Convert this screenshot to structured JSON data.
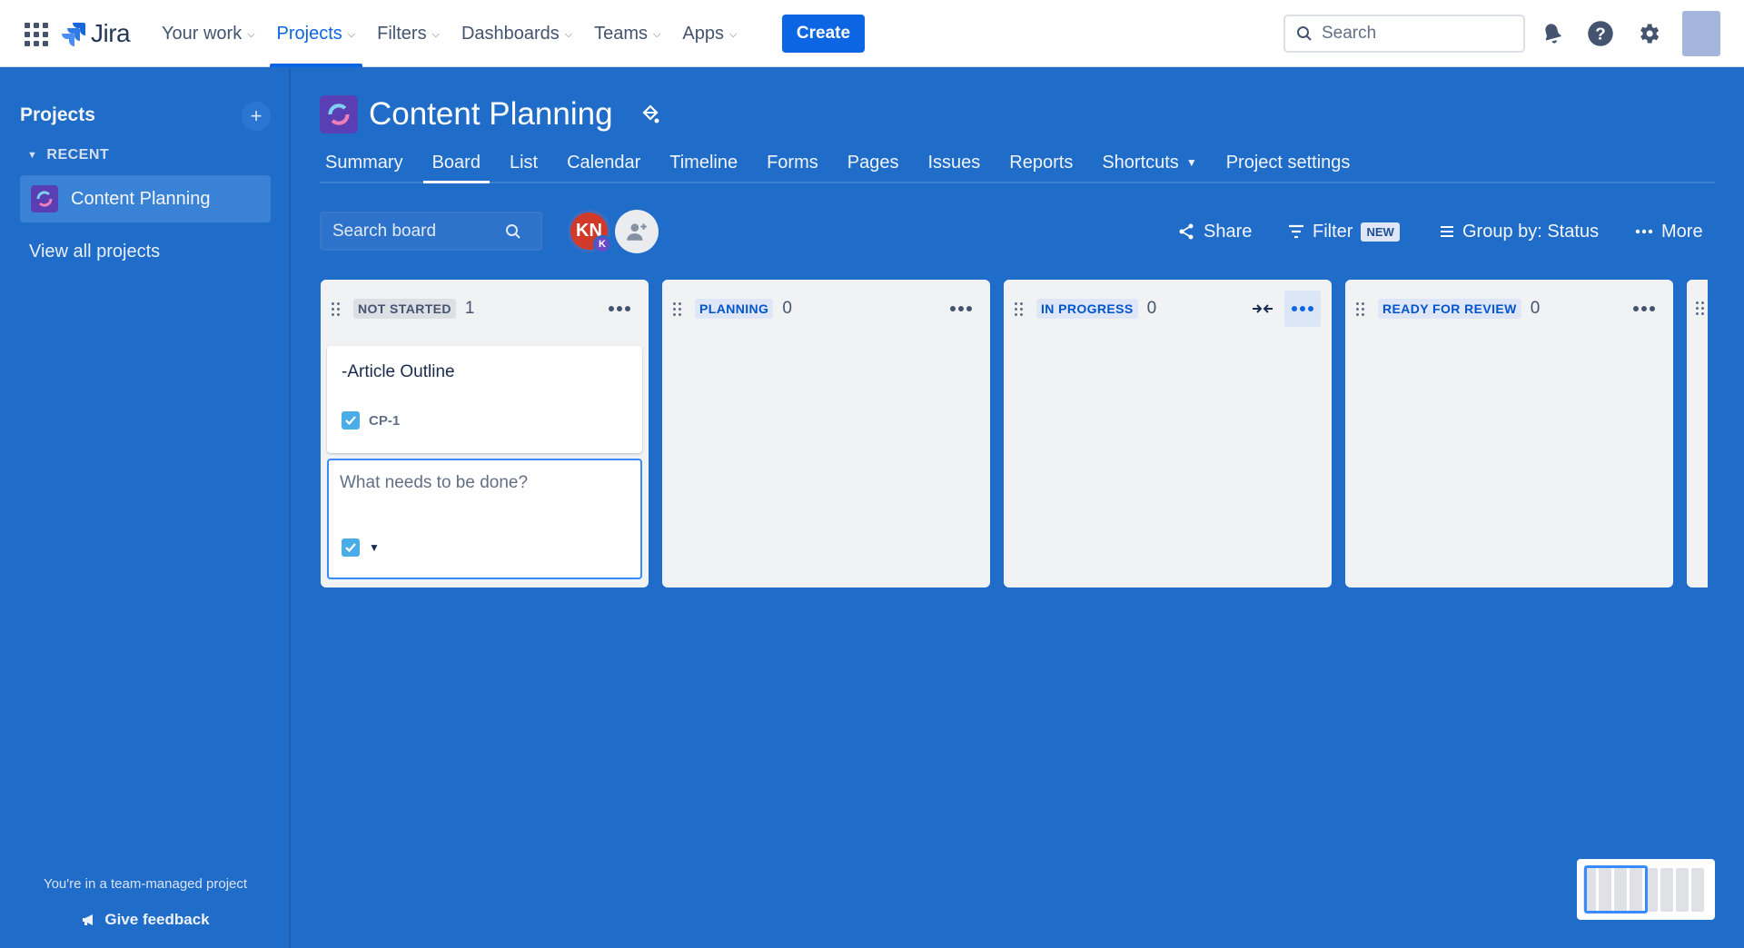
{
  "topnav": {
    "logo_text": "Jira",
    "items": [
      {
        "label": "Your work"
      },
      {
        "label": "Projects"
      },
      {
        "label": "Filters"
      },
      {
        "label": "Dashboards"
      },
      {
        "label": "Teams"
      },
      {
        "label": "Apps"
      }
    ],
    "active_item": "Projects",
    "create_label": "Create",
    "search_placeholder": "Search"
  },
  "sidebar": {
    "title": "Projects",
    "recent_label": "RECENT",
    "project_label": "Content Planning",
    "view_all_label": "View all projects",
    "footer_text": "You're in a team-managed project",
    "feedback_label": "Give feedback"
  },
  "project": {
    "title": "Content Planning",
    "tabs": [
      {
        "label": "Summary"
      },
      {
        "label": "Board"
      },
      {
        "label": "List"
      },
      {
        "label": "Calendar"
      },
      {
        "label": "Timeline"
      },
      {
        "label": "Forms"
      },
      {
        "label": "Pages"
      },
      {
        "label": "Issues"
      },
      {
        "label": "Reports"
      },
      {
        "label": "Shortcuts"
      },
      {
        "label": "Project settings"
      }
    ],
    "active_tab": "Board"
  },
  "board": {
    "search_placeholder": "Search board",
    "avatar_initials": "KN",
    "avatar_badge": "K",
    "share_label": "Share",
    "filter_label": "Filter",
    "filter_badge": "NEW",
    "group_label": "Group by: Status",
    "more_label": "More",
    "columns": [
      {
        "title": "NOT STARTED",
        "count": "1"
      },
      {
        "title": "PLANNING",
        "count": "0"
      },
      {
        "title": "IN PROGRESS",
        "count": "0"
      },
      {
        "title": "READY FOR REVIEW",
        "count": "0"
      }
    ],
    "card": {
      "title": "-Article Outline",
      "key": "CP-1"
    },
    "create_placeholder": "What needs to be done?"
  },
  "colors": {
    "background": "#1f6cc9",
    "accent": "#0c66e4",
    "column": "#f1f2f4",
    "task_icon": "#4bade8",
    "avatar": "#d1392b"
  },
  "icons": [
    "app-switcher-icon",
    "jira-logo-icon",
    "search-icon",
    "bell-icon",
    "help-icon",
    "gear-icon",
    "plus-icon",
    "project-icon",
    "paint-icon",
    "share-icon",
    "filter-icon",
    "group-icon",
    "more-icon",
    "collapse-icon",
    "checkbox-icon",
    "megaphone-icon",
    "add-person-icon"
  ]
}
